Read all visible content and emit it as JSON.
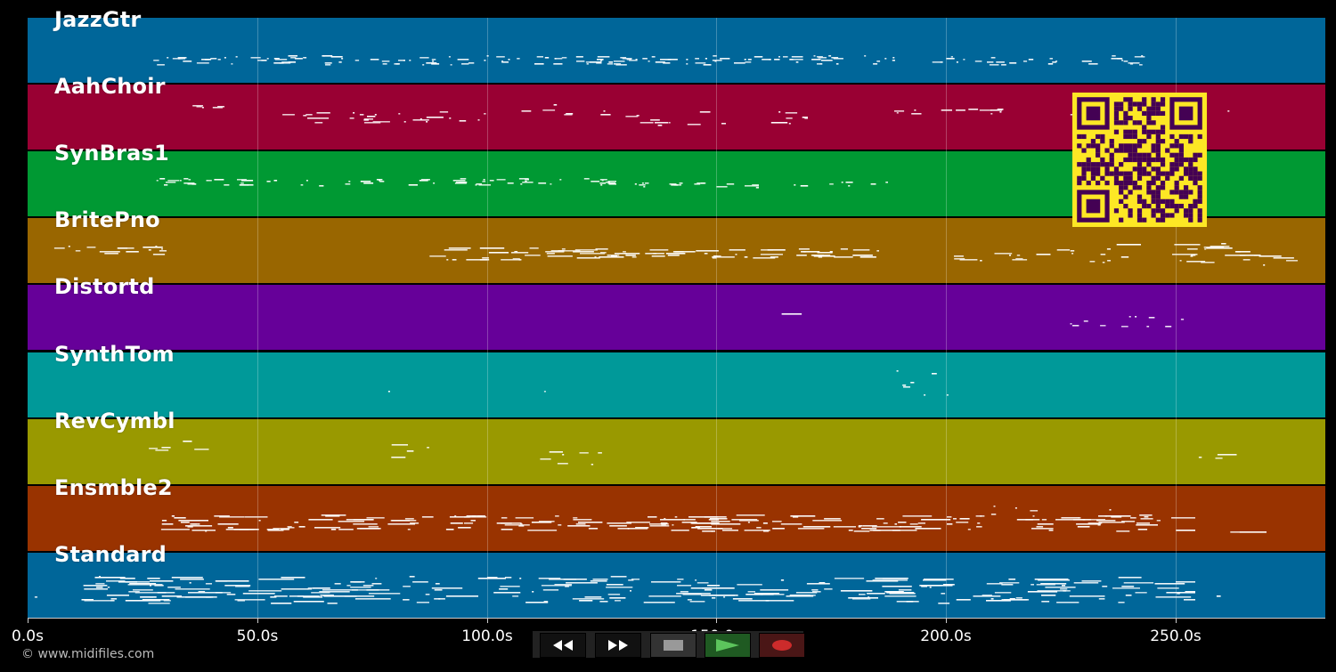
{
  "tracks": [
    {
      "name": "JazzGtr",
      "color": "#006699"
    },
    {
      "name": "AahChoir",
      "color": "#990033"
    },
    {
      "name": "SynBras1",
      "color": "#009933"
    },
    {
      "name": "BritePno",
      "color": "#996600"
    },
    {
      "name": "Distortd",
      "color": "#660099"
    },
    {
      "name": "SynthTom",
      "color": "#009999"
    },
    {
      "name": "RevCymbl",
      "color": "#999900"
    },
    {
      "name": "Ensmble2",
      "color": "#993300"
    },
    {
      "name": "Standard",
      "color": "#006699"
    }
  ],
  "axis": {
    "ticks": [
      "0.0s",
      "50.0s",
      "100.0s",
      "150.0s",
      "200.0s",
      "250.0s"
    ]
  },
  "copyright": "© www.midifiles.com",
  "transport": {
    "rewind_icon": "rewind-icon",
    "fast_forward_icon": "fast-forward-icon",
    "stop_icon": "stop-icon",
    "play_icon": "play-icon",
    "record_icon": "record-icon"
  },
  "colors": {
    "background": "#000000",
    "qr_fg": "#440154",
    "qr_bg": "#fde725",
    "note": "#ffffff"
  }
}
